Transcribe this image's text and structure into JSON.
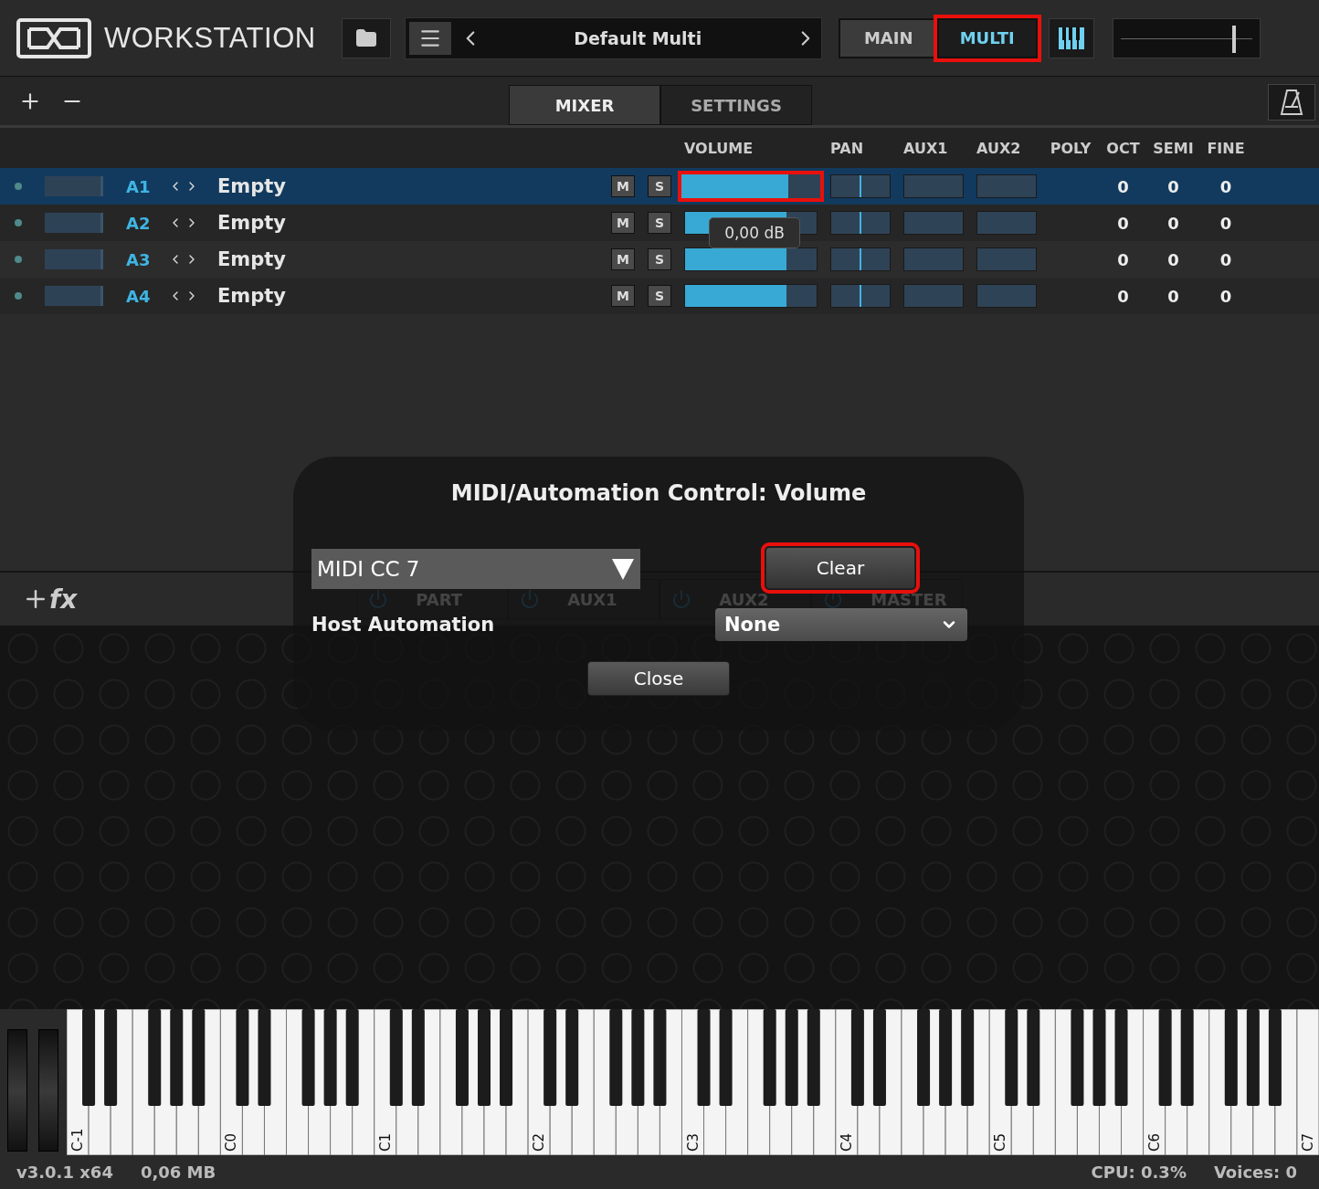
{
  "header": {
    "logo": "WORKSTATION",
    "preset": "Default Multi",
    "view_tabs": [
      {
        "label": "MAIN",
        "selected": false,
        "highlighted": false
      },
      {
        "label": "MULTI",
        "selected": true,
        "highlighted": true
      }
    ],
    "master_volume": {
      "level": 0.86
    }
  },
  "toolbar": {
    "tabs": [
      {
        "label": "MIXER",
        "selected": true
      },
      {
        "label": "SETTINGS",
        "selected": false
      }
    ]
  },
  "mixer": {
    "columns": [
      "VOLUME",
      "PAN",
      "AUX1",
      "AUX2",
      "POLY",
      "OCT",
      "SEMI",
      "FINE"
    ],
    "rows": [
      {
        "part": "A1",
        "name": "Empty",
        "mute": "M",
        "solo": "S",
        "selected": true,
        "volume": {
          "level": 0.77,
          "highlighted": true
        },
        "pan": {
          "level": 0.5
        },
        "aux1": {
          "level": 0
        },
        "aux2": {
          "level": 0
        },
        "oct": "0",
        "semi": "0",
        "fine": "0"
      },
      {
        "part": "A2",
        "name": "Empty",
        "mute": "M",
        "solo": "S",
        "selected": false,
        "volume": {
          "level": 0.77,
          "highlighted": false
        },
        "pan": {
          "level": 0.5
        },
        "aux1": {
          "level": 0
        },
        "aux2": {
          "level": 0
        },
        "oct": "0",
        "semi": "0",
        "fine": "0"
      },
      {
        "part": "A3",
        "name": "Empty",
        "mute": "M",
        "solo": "S",
        "selected": false,
        "volume": {
          "level": 0.77,
          "highlighted": false
        },
        "pan": {
          "level": 0.5
        },
        "aux1": {
          "level": 0
        },
        "aux2": {
          "level": 0
        },
        "oct": "0",
        "semi": "0",
        "fine": "0"
      },
      {
        "part": "A4",
        "name": "Empty",
        "mute": "M",
        "solo": "S",
        "selected": false,
        "volume": {
          "level": 0.77,
          "highlighted": false
        },
        "pan": {
          "level": 0.5
        },
        "aux1": {
          "level": 0
        },
        "aux2": {
          "level": 0
        },
        "oct": "0",
        "semi": "0",
        "fine": "0"
      }
    ],
    "tooltip": "0,00 dB"
  },
  "fx_bar": {
    "label": "fx",
    "tabs": [
      "PART",
      "AUX1",
      "AUX2",
      "MASTER"
    ]
  },
  "dialog": {
    "title": "MIDI/Automation Control: Volume",
    "midi_cc": "MIDI CC 7",
    "clear": {
      "label": "Clear",
      "highlighted": true
    },
    "host_automation_label": "Host Automation",
    "host_automation": "None",
    "close": "Close"
  },
  "keyboard": {
    "octave_labels": [
      "C-1",
      "C0",
      "C1",
      "C2",
      "C3",
      "C4",
      "C5",
      "C6",
      "C7"
    ]
  },
  "status_bar": {
    "version": "v3.0.1 x64",
    "memory": "0,06 MB",
    "cpu": "CPU: 0.3%",
    "voices": "Voices: 0"
  }
}
